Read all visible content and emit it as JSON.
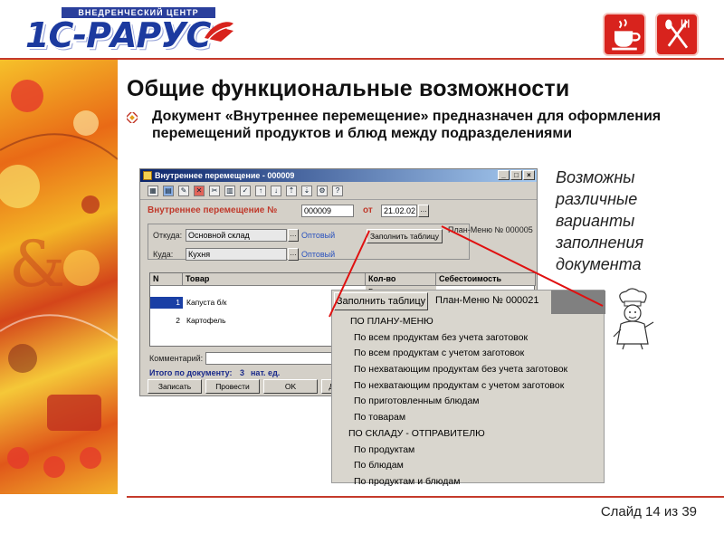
{
  "header": {
    "logo_top": "ВНЕДРЕНЧЕСКИЙ ЦЕНТР",
    "logo_main": "1С-РАРУС"
  },
  "slide": {
    "title": "Общие функциональные возможности",
    "description": "Документ «Внутреннее перемещение» предназначен для оформления перемещений продуктов и блюд между подразделениями",
    "note": "Возможны различные варианты заполнения документа",
    "footer": "Слайд 14 из 39"
  },
  "window": {
    "title": "Внутреннее перемещение - 000009",
    "doc_label": "Внутреннее перемещение №",
    "doc_number": "000009",
    "date_label": "от",
    "date_value": "21.02.02",
    "from_label": "Откуда:",
    "from_value": "Основной склад",
    "from_type": "Оптовый",
    "to_label": "Куда:",
    "to_value": "Кухня",
    "to_type": "Оптовый",
    "fill_button": "Заполнить таблицу",
    "plan_menu": "План-Меню № 000005",
    "columns": [
      "N",
      "Товар",
      "Кол-во",
      "Себестоимость"
    ],
    "col_sub": "Б",
    "rows": [
      {
        "n": "1",
        "item": "Капуста б/к"
      },
      {
        "n": "2",
        "item": "Картофель"
      }
    ],
    "comment_label": "Комментарий:",
    "total_label": "Итого по документу:",
    "total_value": "3",
    "total_unit": "нат. ед.",
    "buttons": [
      "Записать",
      "Провести",
      "OK",
      "Дейст"
    ]
  },
  "popup": {
    "button": "Заполнить таблицу",
    "plan_menu": "План-Меню № 000021",
    "menu_items": [
      {
        "text": "ПО ПЛАНУ-МЕНЮ",
        "kind": "head"
      },
      {
        "text": "По всем продуктам без учета заготовок",
        "kind": "sub"
      },
      {
        "text": "По всем продуктам с учетом заготовок",
        "kind": "sub"
      },
      {
        "text": "По нехватающим продуктам без учета заготовок",
        "kind": "sub"
      },
      {
        "text": "По нехватающим продуктам с учетом заготовок",
        "kind": "sub"
      },
      {
        "text": "По  приготовленным блюдам",
        "kind": "sub"
      },
      {
        "text": "По товарам",
        "kind": "sub"
      },
      {
        "text": "ПО СКЛАДУ - ОТПРАВИТЕЛЮ",
        "kind": "head2"
      },
      {
        "text": "По продуктам",
        "kind": "sub"
      },
      {
        "text": "По блюдам",
        "kind": "sub"
      },
      {
        "text": "По продуктам и блюдам",
        "kind": "sub"
      }
    ]
  },
  "colors": {
    "brand_blue": "#1c3a9f",
    "accent_red": "#c53a2b",
    "callout_red": "#e01010"
  }
}
